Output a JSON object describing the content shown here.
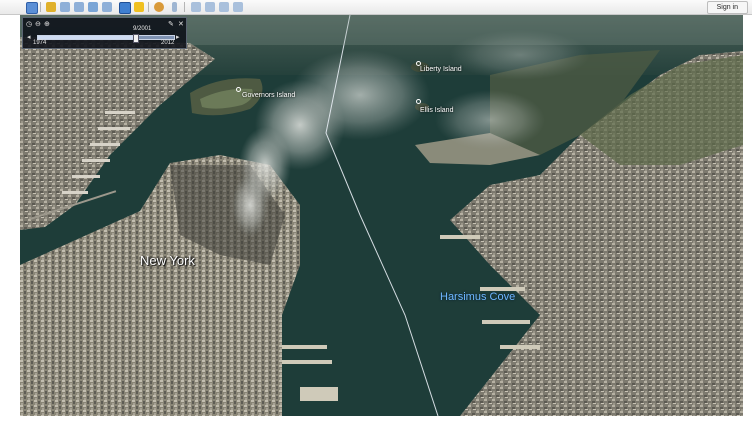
{
  "toolbar": {
    "signin_label": "Sign in",
    "icons": [
      "sidebar-icon",
      "placemark-icon",
      "polygon-icon",
      "path-icon",
      "overlay-icon",
      "tour-icon",
      "history-icon",
      "sun-icon",
      "planet-icon",
      "ruler-icon",
      "email-icon",
      "print-icon",
      "save-image-icon",
      "maps-icon"
    ]
  },
  "time_slider": {
    "current_date": "9/2001",
    "start_year": "1974",
    "end_year": "2012",
    "position_fraction": 0.71
  },
  "map": {
    "labels": {
      "city": "New York",
      "governors": "Governors Island",
      "liberty": "Liberty Island",
      "ellis": "Ellis Island",
      "harsimus": "Harsimus Cove"
    },
    "colors": {
      "water": "#1e3d39",
      "smoke": "#c8ccc8",
      "label_blue": "#6fb7ff"
    }
  }
}
